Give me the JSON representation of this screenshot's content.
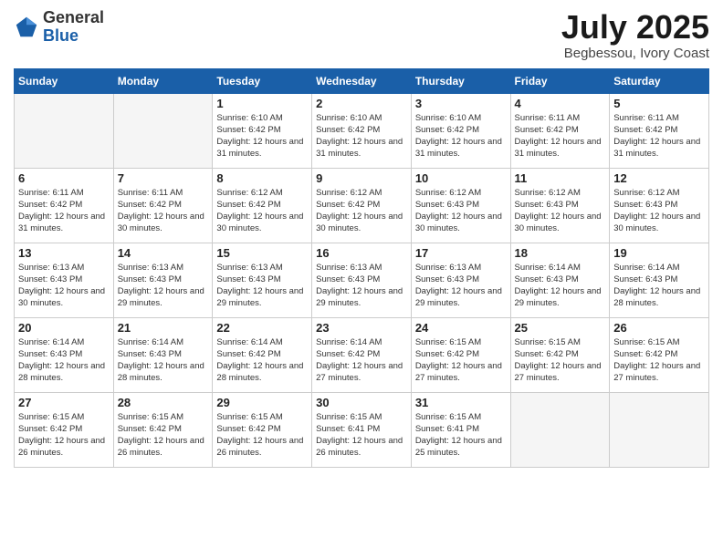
{
  "header": {
    "logo_general": "General",
    "logo_blue": "Blue",
    "month_year": "July 2025",
    "location": "Begbessou, Ivory Coast"
  },
  "weekdays": [
    "Sunday",
    "Monday",
    "Tuesday",
    "Wednesday",
    "Thursday",
    "Friday",
    "Saturday"
  ],
  "weeks": [
    [
      {
        "day": "",
        "empty": true
      },
      {
        "day": "",
        "empty": true
      },
      {
        "day": "1",
        "sunrise": "Sunrise: 6:10 AM",
        "sunset": "Sunset: 6:42 PM",
        "daylight": "Daylight: 12 hours and 31 minutes."
      },
      {
        "day": "2",
        "sunrise": "Sunrise: 6:10 AM",
        "sunset": "Sunset: 6:42 PM",
        "daylight": "Daylight: 12 hours and 31 minutes."
      },
      {
        "day": "3",
        "sunrise": "Sunrise: 6:10 AM",
        "sunset": "Sunset: 6:42 PM",
        "daylight": "Daylight: 12 hours and 31 minutes."
      },
      {
        "day": "4",
        "sunrise": "Sunrise: 6:11 AM",
        "sunset": "Sunset: 6:42 PM",
        "daylight": "Daylight: 12 hours and 31 minutes."
      },
      {
        "day": "5",
        "sunrise": "Sunrise: 6:11 AM",
        "sunset": "Sunset: 6:42 PM",
        "daylight": "Daylight: 12 hours and 31 minutes."
      }
    ],
    [
      {
        "day": "6",
        "sunrise": "Sunrise: 6:11 AM",
        "sunset": "Sunset: 6:42 PM",
        "daylight": "Daylight: 12 hours and 31 minutes."
      },
      {
        "day": "7",
        "sunrise": "Sunrise: 6:11 AM",
        "sunset": "Sunset: 6:42 PM",
        "daylight": "Daylight: 12 hours and 30 minutes."
      },
      {
        "day": "8",
        "sunrise": "Sunrise: 6:12 AM",
        "sunset": "Sunset: 6:42 PM",
        "daylight": "Daylight: 12 hours and 30 minutes."
      },
      {
        "day": "9",
        "sunrise": "Sunrise: 6:12 AM",
        "sunset": "Sunset: 6:42 PM",
        "daylight": "Daylight: 12 hours and 30 minutes."
      },
      {
        "day": "10",
        "sunrise": "Sunrise: 6:12 AM",
        "sunset": "Sunset: 6:43 PM",
        "daylight": "Daylight: 12 hours and 30 minutes."
      },
      {
        "day": "11",
        "sunrise": "Sunrise: 6:12 AM",
        "sunset": "Sunset: 6:43 PM",
        "daylight": "Daylight: 12 hours and 30 minutes."
      },
      {
        "day": "12",
        "sunrise": "Sunrise: 6:12 AM",
        "sunset": "Sunset: 6:43 PM",
        "daylight": "Daylight: 12 hours and 30 minutes."
      }
    ],
    [
      {
        "day": "13",
        "sunrise": "Sunrise: 6:13 AM",
        "sunset": "Sunset: 6:43 PM",
        "daylight": "Daylight: 12 hours and 30 minutes."
      },
      {
        "day": "14",
        "sunrise": "Sunrise: 6:13 AM",
        "sunset": "Sunset: 6:43 PM",
        "daylight": "Daylight: 12 hours and 29 minutes."
      },
      {
        "day": "15",
        "sunrise": "Sunrise: 6:13 AM",
        "sunset": "Sunset: 6:43 PM",
        "daylight": "Daylight: 12 hours and 29 minutes."
      },
      {
        "day": "16",
        "sunrise": "Sunrise: 6:13 AM",
        "sunset": "Sunset: 6:43 PM",
        "daylight": "Daylight: 12 hours and 29 minutes."
      },
      {
        "day": "17",
        "sunrise": "Sunrise: 6:13 AM",
        "sunset": "Sunset: 6:43 PM",
        "daylight": "Daylight: 12 hours and 29 minutes."
      },
      {
        "day": "18",
        "sunrise": "Sunrise: 6:14 AM",
        "sunset": "Sunset: 6:43 PM",
        "daylight": "Daylight: 12 hours and 29 minutes."
      },
      {
        "day": "19",
        "sunrise": "Sunrise: 6:14 AM",
        "sunset": "Sunset: 6:43 PM",
        "daylight": "Daylight: 12 hours and 28 minutes."
      }
    ],
    [
      {
        "day": "20",
        "sunrise": "Sunrise: 6:14 AM",
        "sunset": "Sunset: 6:43 PM",
        "daylight": "Daylight: 12 hours and 28 minutes."
      },
      {
        "day": "21",
        "sunrise": "Sunrise: 6:14 AM",
        "sunset": "Sunset: 6:43 PM",
        "daylight": "Daylight: 12 hours and 28 minutes."
      },
      {
        "day": "22",
        "sunrise": "Sunrise: 6:14 AM",
        "sunset": "Sunset: 6:42 PM",
        "daylight": "Daylight: 12 hours and 28 minutes."
      },
      {
        "day": "23",
        "sunrise": "Sunrise: 6:14 AM",
        "sunset": "Sunset: 6:42 PM",
        "daylight": "Daylight: 12 hours and 27 minutes."
      },
      {
        "day": "24",
        "sunrise": "Sunrise: 6:15 AM",
        "sunset": "Sunset: 6:42 PM",
        "daylight": "Daylight: 12 hours and 27 minutes."
      },
      {
        "day": "25",
        "sunrise": "Sunrise: 6:15 AM",
        "sunset": "Sunset: 6:42 PM",
        "daylight": "Daylight: 12 hours and 27 minutes."
      },
      {
        "day": "26",
        "sunrise": "Sunrise: 6:15 AM",
        "sunset": "Sunset: 6:42 PM",
        "daylight": "Daylight: 12 hours and 27 minutes."
      }
    ],
    [
      {
        "day": "27",
        "sunrise": "Sunrise: 6:15 AM",
        "sunset": "Sunset: 6:42 PM",
        "daylight": "Daylight: 12 hours and 26 minutes."
      },
      {
        "day": "28",
        "sunrise": "Sunrise: 6:15 AM",
        "sunset": "Sunset: 6:42 PM",
        "daylight": "Daylight: 12 hours and 26 minutes."
      },
      {
        "day": "29",
        "sunrise": "Sunrise: 6:15 AM",
        "sunset": "Sunset: 6:42 PM",
        "daylight": "Daylight: 12 hours and 26 minutes."
      },
      {
        "day": "30",
        "sunrise": "Sunrise: 6:15 AM",
        "sunset": "Sunset: 6:41 PM",
        "daylight": "Daylight: 12 hours and 26 minutes."
      },
      {
        "day": "31",
        "sunrise": "Sunrise: 6:15 AM",
        "sunset": "Sunset: 6:41 PM",
        "daylight": "Daylight: 12 hours and 25 minutes."
      },
      {
        "day": "",
        "empty": true
      },
      {
        "day": "",
        "empty": true
      }
    ]
  ]
}
